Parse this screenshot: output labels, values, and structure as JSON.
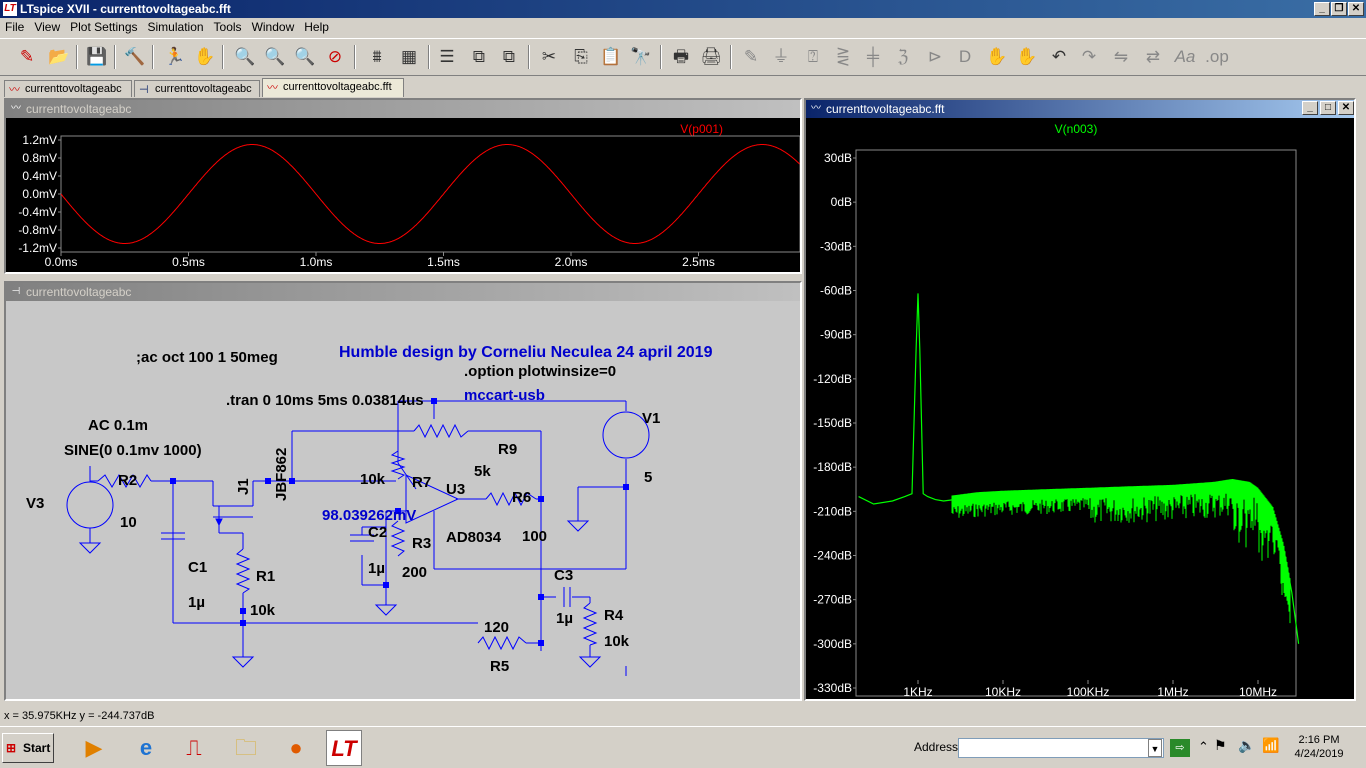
{
  "window": {
    "title": "LTspice XVII - currenttovoltageabc.fft"
  },
  "menu": [
    "File",
    "View",
    "Plot Settings",
    "Simulation",
    "Tools",
    "Window",
    "Help"
  ],
  "tabs": [
    {
      "label": "currenttovoltageabc"
    },
    {
      "label": "currenttovoltageabc"
    },
    {
      "label": "currenttovoltageabc.fft"
    }
  ],
  "time_pane": {
    "title": "currenttovoltageabc",
    "trace": "V(p001)",
    "trace_color": "#ff0000"
  },
  "schematic_pane": {
    "title": "currenttovoltageabc",
    "texts": {
      "ac": ";ac oct 100 1 50meg",
      "credit": "Humble design by Corneliu Neculea 24 april 2019",
      "option": ".option plotwinsize=0",
      "tran": ".tran 0 10ms 5ms 0.03814us",
      "board": "mccart-usb",
      "acsrc": "AC 0.1m",
      "sine": "SINE(0 0.1mv 1000)",
      "probe": "98.039262mV"
    },
    "labels": {
      "v3": "V3",
      "r2": "R2",
      "r2v": "10",
      "j1": "J1",
      "jbf": "JBF862",
      "c1": "C1",
      "c1v": "1µ",
      "r1": "R1",
      "r1v": "10k",
      "c2": "C2",
      "c2v": "1µ",
      "r3": "R3",
      "r3v": "200",
      "r7": "R7",
      "r7v": "10k",
      "u3": "U3",
      "u3v": "AD8034",
      "r9": "R9",
      "r9v": "5k",
      "r6": "R6",
      "r6v": "100",
      "v1": "V1",
      "v1v": "5",
      "c3": "C3",
      "c3v": "1µ",
      "r4": "R4",
      "r4v": "10k",
      "r5": "R5",
      "r5v": "120"
    }
  },
  "fft_pane": {
    "title": "currenttovoltageabc.fft",
    "trace": "V(n003)",
    "trace_color": "#00ff00"
  },
  "status_bar": {
    "cursor": "x = 35.975KHz   y = -244.737dB"
  },
  "taskbar": {
    "start": "Start",
    "address_label": "Address",
    "time": "2:16 PM",
    "date": "4/24/2019"
  },
  "chart_data": [
    {
      "type": "line",
      "title": "V(p001)",
      "xlabel": "",
      "ylabel": "",
      "x_ticks": [
        "0.0ms",
        "0.5ms",
        "1.0ms",
        "1.5ms",
        "2.0ms",
        "2.5ms"
      ],
      "y_ticks": [
        "1.2mV",
        "0.8mV",
        "0.4mV",
        "0.0mV",
        "-0.4mV",
        "-0.8mV",
        "-1.2mV"
      ],
      "xlim": [
        0,
        2.9
      ],
      "ylim": [
        -1.2,
        1.2
      ],
      "grid": false,
      "series": [
        {
          "name": "V(p001)",
          "color": "#ff0000",
          "function": "sine",
          "amplitude_mV": 1.1,
          "frequency_kHz": 1,
          "phase_deg": 180
        }
      ]
    },
    {
      "type": "line",
      "title": "V(n003)",
      "xlabel": "",
      "ylabel": "",
      "x_scale": "log",
      "x_ticks": [
        "1KHz",
        "10KHz",
        "100KHz",
        "1MHz",
        "10MHz"
      ],
      "y_ticks": [
        "30dB",
        "0dB",
        "-30dB",
        "-60dB",
        "-90dB",
        "-120dB",
        "-150dB",
        "-180dB",
        "-210dB",
        "-240dB",
        "-270dB",
        "-300dB",
        "-330dB"
      ],
      "ylim": [
        -330,
        30
      ],
      "grid": false,
      "series": [
        {
          "name": "V(n003)",
          "color": "#00ff00",
          "x_Hz": [
            200,
            300,
            500,
            700,
            850,
            950,
            1000,
            1050,
            1150,
            1300,
            1600,
            2000,
            5000,
            10000,
            30000,
            100000,
            300000,
            1000000,
            3000000,
            5000000,
            8000000,
            10000000,
            15000000,
            20000000,
            25000000,
            30000000
          ],
          "y_dB": [
            -200,
            -205,
            -203,
            -200,
            -198,
            -100,
            -62,
            -100,
            -198,
            -200,
            -202,
            -203,
            -200,
            -199,
            -198,
            -197,
            -196,
            -195,
            -193,
            -191,
            -193,
            -197,
            -210,
            -235,
            -265,
            -300
          ]
        }
      ]
    }
  ]
}
